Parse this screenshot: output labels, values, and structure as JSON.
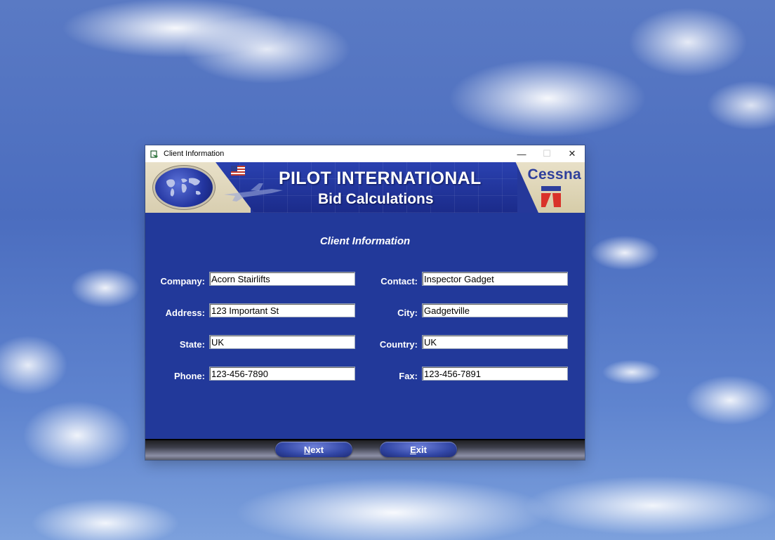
{
  "window": {
    "title": "Client Information",
    "controls": {
      "minimize": "—",
      "maximize": "☐",
      "close": "✕"
    }
  },
  "banner": {
    "title": "PILOT INTERNATIONAL",
    "subtitle": "Bid Calculations",
    "brand": "Cessna",
    "globe_logo": "globe-logo",
    "cessna_logo": "cessna-logo"
  },
  "form": {
    "heading": "Client Information",
    "fields": {
      "company": {
        "label": "Company:",
        "value": "Acorn Stairlifts"
      },
      "contact": {
        "label": "Contact:",
        "value": "Inspector Gadget"
      },
      "address": {
        "label": "Address:",
        "value": "123 Important St"
      },
      "city": {
        "label": "City:",
        "value": "Gadgetville"
      },
      "state": {
        "label": "State:",
        "value": "UK"
      },
      "country": {
        "label": "Country:",
        "value": "UK"
      },
      "phone": {
        "label": "Phone:",
        "value": "123-456-7890"
      },
      "fax": {
        "label": "Fax:",
        "value": "123-456-7891"
      }
    }
  },
  "buttons": {
    "next": {
      "accel": "N",
      "rest": "ext"
    },
    "exit": {
      "accel": "E",
      "rest": "xit"
    }
  },
  "colors": {
    "form_background": "#22399a",
    "banner_tan": "#e8e0c8",
    "label_text": "#ffffff",
    "cessna_blue": "#2e3f9c",
    "cessna_red": "#d9322a"
  }
}
